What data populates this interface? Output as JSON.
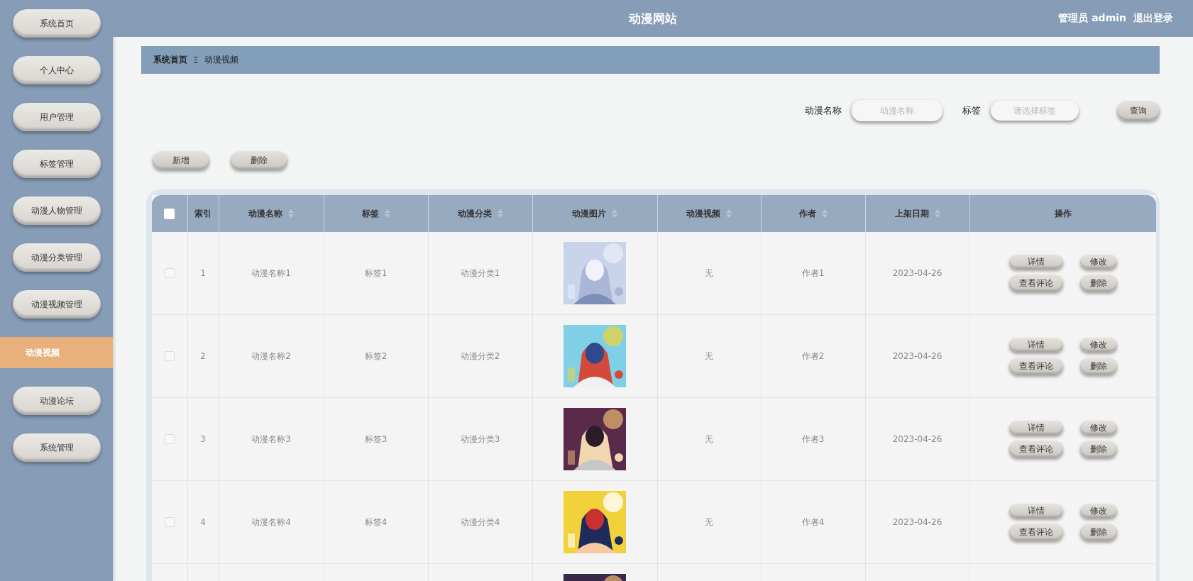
{
  "header": {
    "title": "动漫网站",
    "user": "管理员 admin",
    "logout": "退出登录"
  },
  "sidebar": {
    "items": [
      {
        "label": "系统首页",
        "selected": false
      },
      {
        "label": "个人中心",
        "selected": false
      },
      {
        "label": "用户管理",
        "selected": false
      },
      {
        "label": "标签管理",
        "selected": false
      },
      {
        "label": "动漫人物管理",
        "selected": false
      },
      {
        "label": "动漫分类管理",
        "selected": false
      },
      {
        "label": "动漫视频管理",
        "selected": false
      },
      {
        "label": "动漫视频",
        "selected": true
      },
      {
        "label": "动漫论坛",
        "selected": false
      },
      {
        "label": "系统管理",
        "selected": false
      }
    ]
  },
  "breadcrumb": {
    "home": "系统首页",
    "separator": "Ξ",
    "current": "动漫视频"
  },
  "search": {
    "fields": [
      {
        "label": "动漫名称",
        "placeholder": "动漫名称",
        "kind": "input"
      },
      {
        "label": "标签",
        "placeholder": "请选择标签",
        "kind": "select"
      }
    ],
    "button": "查询"
  },
  "actions": [
    "新增",
    "删除"
  ],
  "table": {
    "header_checkbox": {
      "checked": false
    },
    "columns": [
      {
        "label": "索引",
        "sortable": false
      },
      {
        "label": "动漫名称",
        "sortable": true
      },
      {
        "label": "标签",
        "sortable": true
      },
      {
        "label": "动漫分类",
        "sortable": true
      },
      {
        "label": "动漫图片",
        "sortable": true
      },
      {
        "label": "动漫视频",
        "sortable": true
      },
      {
        "label": "作者",
        "sortable": true
      },
      {
        "label": "上架日期",
        "sortable": true
      },
      {
        "label": "操作",
        "sortable": false
      }
    ],
    "rows": [
      {
        "checked": false,
        "index": "1",
        "name": "动漫名称1",
        "tag": "标签1",
        "category": "动漫分类1",
        "picture": {
          "kind": "picture"
        },
        "video": "无",
        "author": "作者1",
        "date": "2023-04-26",
        "buttons": [
          "详情",
          "修改",
          "查看评论",
          "删除"
        ]
      },
      {
        "checked": false,
        "index": "2",
        "name": "动漫名称2",
        "tag": "标签2",
        "category": "动漫分类2",
        "picture": {
          "kind": "picture"
        },
        "video": "无",
        "author": "作者2",
        "date": "2023-04-26",
        "buttons": [
          "详情",
          "修改",
          "查看评论",
          "删除"
        ]
      },
      {
        "checked": false,
        "index": "3",
        "name": "动漫名称3",
        "tag": "标签3",
        "category": "动漫分类3",
        "picture": {
          "kind": "picture"
        },
        "video": "无",
        "author": "作者3",
        "date": "2023-04-26",
        "buttons": [
          "详情",
          "修改",
          "查看评论",
          "删除"
        ]
      },
      {
        "checked": false,
        "index": "4",
        "name": "动漫名称4",
        "tag": "标签4",
        "category": "动漫分类4",
        "picture": {
          "kind": "picture"
        },
        "video": "无",
        "author": "作者4",
        "date": "2023-04-26",
        "buttons": [
          "详情",
          "修改",
          "查看评论",
          "删除"
        ]
      },
      {
        "picture": {
          "kind": "picture"
        }
      }
    ]
  }
}
